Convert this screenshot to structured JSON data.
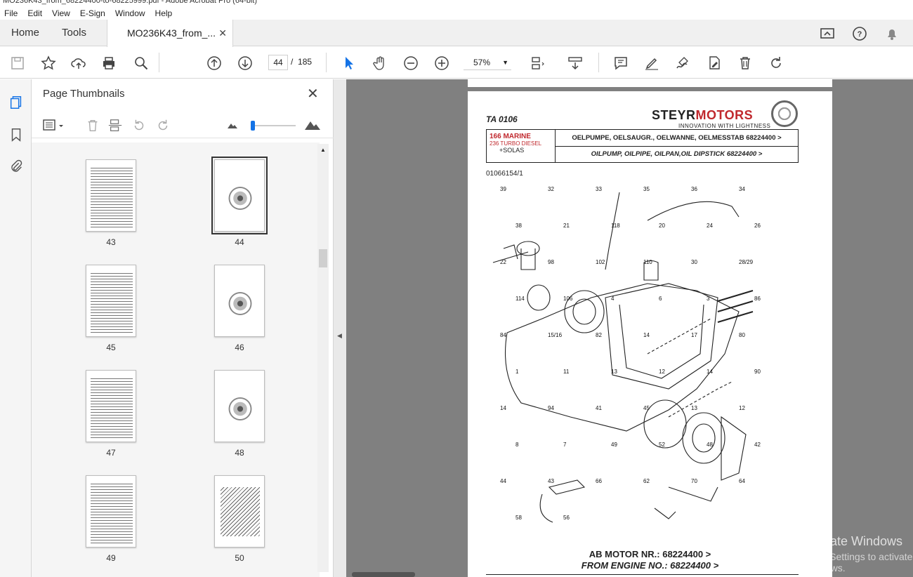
{
  "window": {
    "title": "MO236K43_from_68224400-to-68225999.pdf - Adobe Acrobat Pro (64-bit)"
  },
  "menu": [
    "File",
    "Edit",
    "View",
    "E-Sign",
    "Window",
    "Help"
  ],
  "tabs": {
    "home": "Home",
    "tools": "Tools",
    "document": "MO236K43_from_...",
    "close": "✕"
  },
  "toolbar": {
    "page_current": "44",
    "page_separator": "/",
    "page_total": "185",
    "zoom": "57%"
  },
  "panel": {
    "title": "Page Thumbnails",
    "close": "✕",
    "thumbnails": [
      {
        "label": "43",
        "kind": "list"
      },
      {
        "label": "44",
        "kind": "drawing",
        "selected": true
      },
      {
        "label": "45",
        "kind": "list"
      },
      {
        "label": "46",
        "kind": "drawing"
      },
      {
        "label": "47",
        "kind": "list"
      },
      {
        "label": "48",
        "kind": "drawing"
      },
      {
        "label": "49",
        "kind": "list"
      },
      {
        "label": "50",
        "kind": "drawing"
      }
    ]
  },
  "document_page": {
    "ref": "TA 0106",
    "brand_a": "STEYR",
    "brand_b": "MOTORS",
    "slogan": "INNOVATION WITH LIGHTNESS",
    "product_line1": "166 MARINE",
    "product_line2": "236 TURBO DIESEL",
    "product_line3": "+SOLAS",
    "title_de": "OELPUMPE, OELSAUGR., OELWANNE, OELMESSTAB 68224400 >",
    "title_en": "OILPUMP, OILPIPE, OILPAN,OIL DIPSTICK 68224400 >",
    "part_id": "01066154/1",
    "footer_de": "AB MOTOR NR.: 68224400 >",
    "footer_en": "FROM ENGINE NO.: 68224400 >",
    "callouts": [
      "39",
      "32",
      "33",
      "35",
      "36",
      "34",
      "38",
      "21",
      "118",
      "20",
      "24",
      "26",
      "22",
      "98",
      "102",
      "110",
      "30",
      "28/29",
      "114",
      "106",
      "4",
      "6",
      "3",
      "86",
      "84",
      "15/16",
      "82",
      "14",
      "17",
      "80",
      "1",
      "11",
      "13",
      "12",
      "14",
      "90",
      "14",
      "94",
      "41",
      "45",
      "13",
      "12",
      "8",
      "7",
      "49",
      "52",
      "48",
      "42",
      "44",
      "43",
      "66",
      "62",
      "70",
      "64",
      "58",
      "56"
    ]
  },
  "os": {
    "watermark1": "Activate Windows",
    "watermark2": "Go to Settings to activate Windows."
  }
}
